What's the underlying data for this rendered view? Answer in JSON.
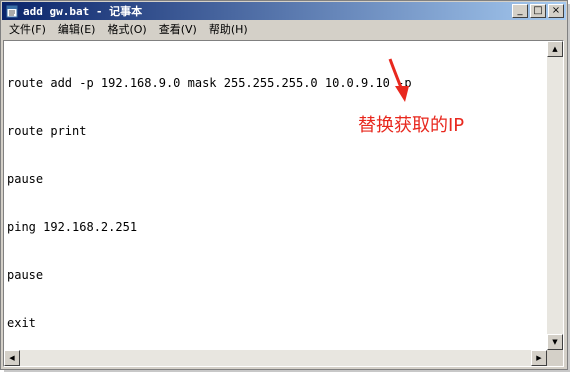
{
  "window": {
    "title": "add gw.bat - 记事本",
    "icon": "notepad-icon",
    "controls": {
      "minimize": "_",
      "maximize": "□",
      "close": "×"
    }
  },
  "menu": {
    "items": [
      {
        "label": "文件(F)"
      },
      {
        "label": "编辑(E)"
      },
      {
        "label": "格式(O)"
      },
      {
        "label": "查看(V)"
      },
      {
        "label": "帮助(H)"
      }
    ]
  },
  "document": {
    "lines": [
      "route add -p 192.168.9.0 mask 255.255.255.0 10.0.9.10 -p",
      "route print",
      "pause",
      "ping 192.168.2.251",
      "pause",
      "exit"
    ]
  },
  "annotation": {
    "text": "替换获取的IP",
    "color": "#e8281e"
  },
  "scrollbar": {
    "up": "▲",
    "down": "▼",
    "left": "◀",
    "right": "▶"
  }
}
